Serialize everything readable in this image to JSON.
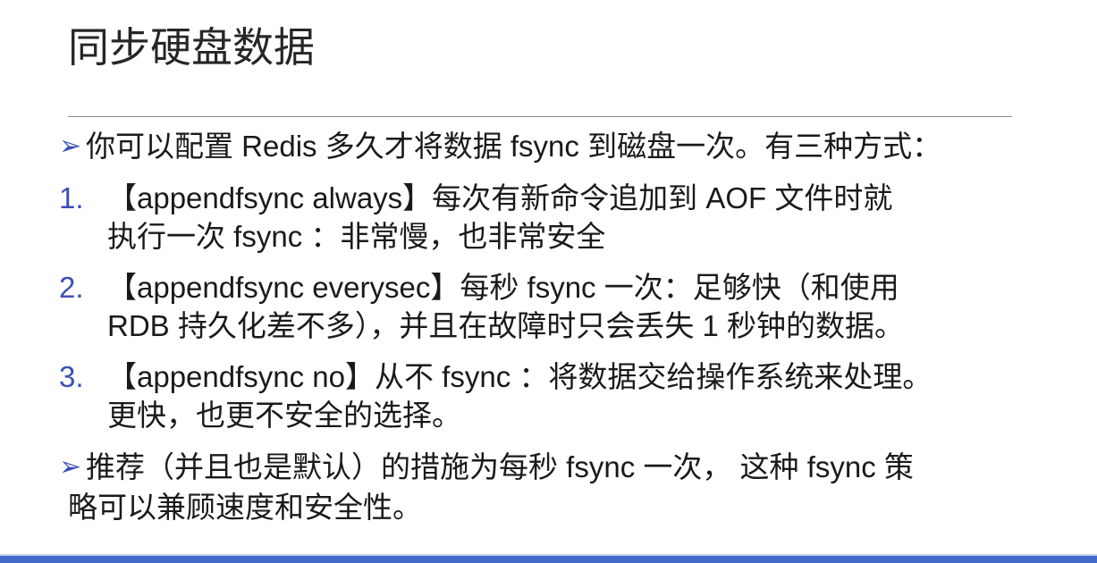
{
  "title": "同步硬盘数据",
  "bullets": {
    "marker": "➢",
    "intro": "你可以配置 Redis 多久才将数据 fsync 到磁盘一次。有三种方式：",
    "recommend_line1": "推荐（并且也是默认）的措施为每秒 fsync 一次， 这种 fsync 策",
    "recommend_line2": "略可以兼顾速度和安全性。"
  },
  "options": [
    {
      "number": "1.",
      "line1": "【appendfsync always】每次有新命令追加到 AOF 文件时就",
      "line2": "执行一次 fsync ：非常慢，也非常安全"
    },
    {
      "number": "2.",
      "line1": "【appendfsync everysec】每秒 fsync 一次：足够快（和使用",
      "line2": "RDB 持久化差不多），并且在故障时只会丢失 1 秒钟的数据。"
    },
    {
      "number": "3.",
      "line1": "【appendfsync no】从不 fsync ：将数据交给操作系统来处理。",
      "line2": "更快，也更不安全的选择。"
    }
  ],
  "colors": {
    "accent": "#3a4fb8",
    "bottom_bar": "#4169c7",
    "text": "#1a1a1a"
  }
}
